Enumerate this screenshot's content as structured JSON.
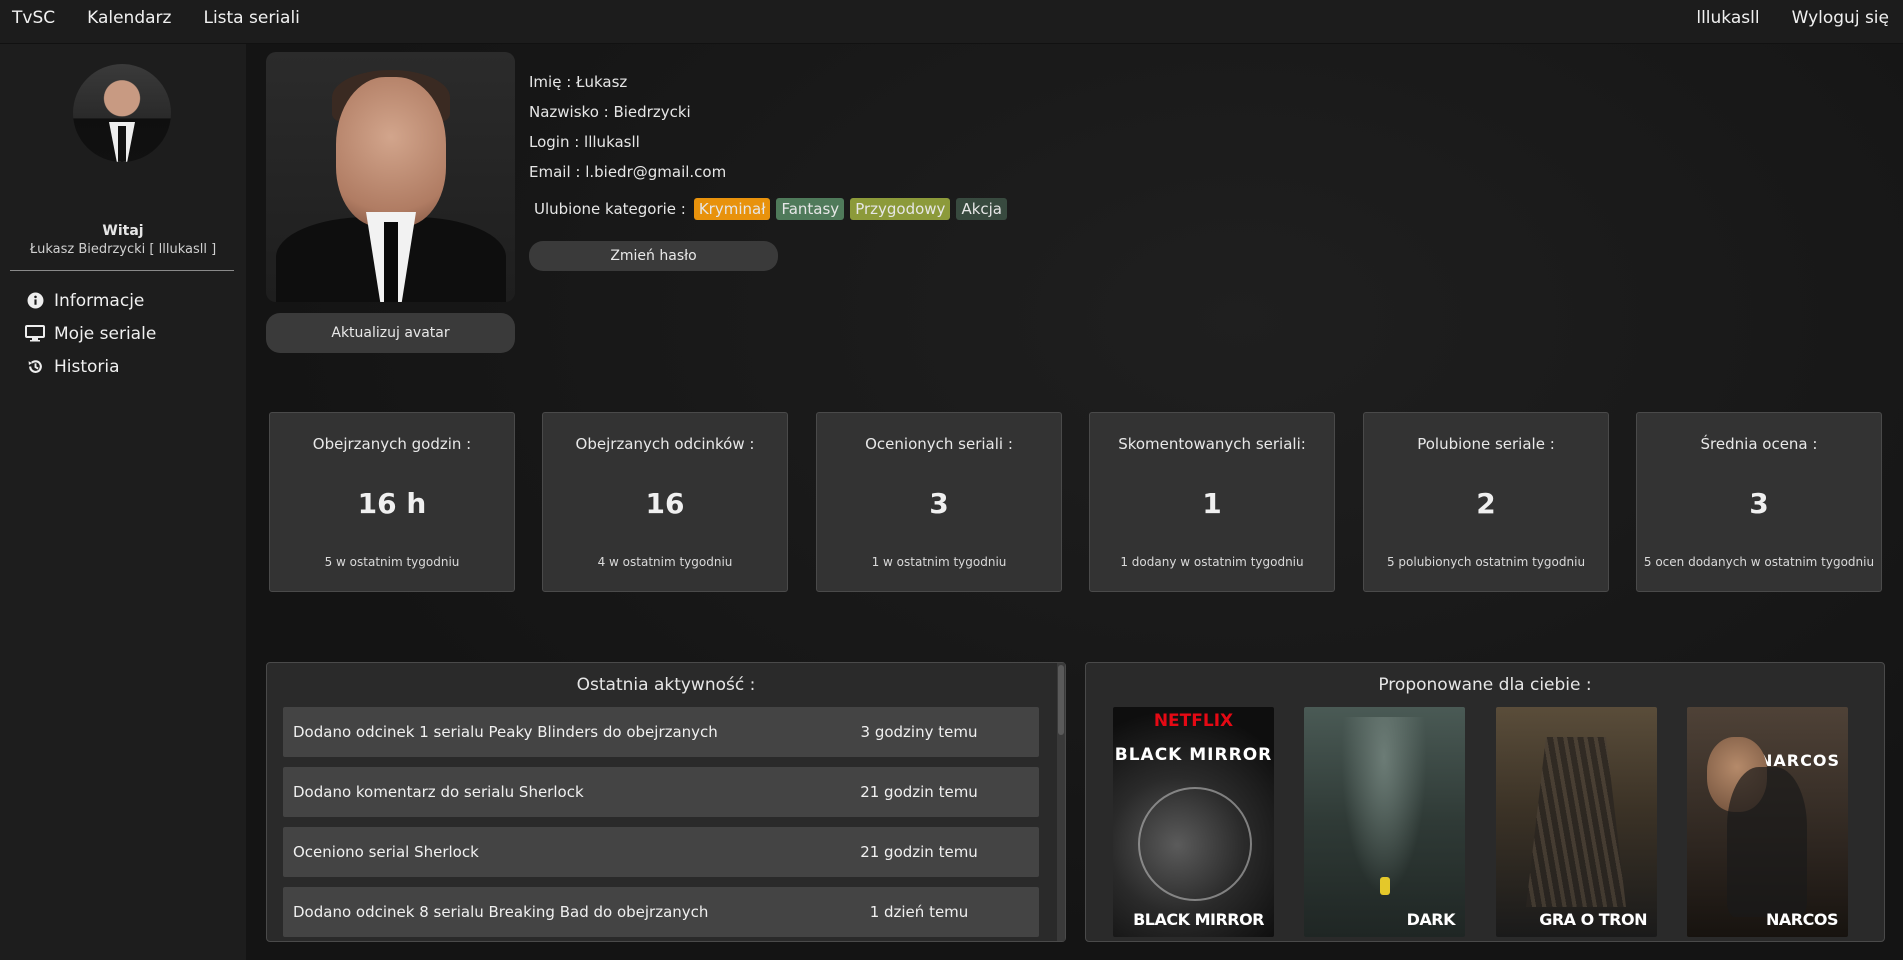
{
  "topbar": {
    "left": [
      "TvSC",
      "Kalendarz",
      "Lista seriali"
    ],
    "right": [
      "lllukasll",
      "Wyloguj się"
    ]
  },
  "sidebar": {
    "welcome": "Witaj",
    "name": "Łukasz Biedrzycki [ lllukasll ]",
    "items": [
      {
        "label": "Informacje",
        "icon": "info-circle-icon"
      },
      {
        "label": "Moje seriale",
        "icon": "monitor-icon"
      },
      {
        "label": "Historia",
        "icon": "history-icon"
      }
    ]
  },
  "profile": {
    "first_name": "Imię : Łukasz",
    "last_name": "Nazwisko : Biedrzycki",
    "login": "Login : lllukasll",
    "email": "Email : l.biedr@gmail.com",
    "fav_label": "Ulubione kategorie :",
    "tags": [
      {
        "label": "Kryminał",
        "color": "#e8920c"
      },
      {
        "label": "Fantasy",
        "color": "#4f7a5a"
      },
      {
        "label": "Przygodowy",
        "color": "#8c9a3a"
      },
      {
        "label": "Akcja",
        "color": "#384a3f"
      }
    ],
    "change_password": "Zmień hasło",
    "update_avatar": "Aktualizuj avatar"
  },
  "stats": [
    {
      "title": "Obejrzanych godzin :",
      "value": "16 h",
      "sub": "5 w ostatnim tygodniu"
    },
    {
      "title": "Obejrzanych odcinków :",
      "value": "16",
      "sub": "4 w ostatnim tygodniu"
    },
    {
      "title": "Ocenionych seriali :",
      "value": "3",
      "sub": "1 w ostatnim tygodniu"
    },
    {
      "title": "Skomentowanych seriali:",
      "value": "1",
      "sub": "1 dodany w ostatnim tygodniu"
    },
    {
      "title": "Polubione seriale :",
      "value": "2",
      "sub": "5 polubionych ostatnim tygodniu"
    },
    {
      "title": "Średnia ocena :",
      "value": "3",
      "sub": "5 ocen dodanych w ostatnim tygodniu"
    }
  ],
  "activity": {
    "title": "Ostatnia aktywność :",
    "rows": [
      {
        "text": "Dodano odcinek 1 serialu Peaky Blinders do obejrzanych",
        "time": "3 godziny temu"
      },
      {
        "text": "Dodano komentarz do serialu Sherlock",
        "time": "21 godzin temu"
      },
      {
        "text": "Oceniono serial Sherlock",
        "time": "21 godzin temu"
      },
      {
        "text": "Dodano odcinek 8 serialu Breaking Bad do obejrzanych",
        "time": "1 dzień temu"
      }
    ]
  },
  "suggested": {
    "title": "Proponowane dla ciebie :",
    "posters": [
      {
        "title": "BLACK MIRROR",
        "top_text": "NETFLIX",
        "art_text": "BLACK MIRROR"
      },
      {
        "title": "DARK"
      },
      {
        "title": "GRA O TRON"
      },
      {
        "title": "NARCOS",
        "art_text": "NARCOS"
      }
    ]
  }
}
